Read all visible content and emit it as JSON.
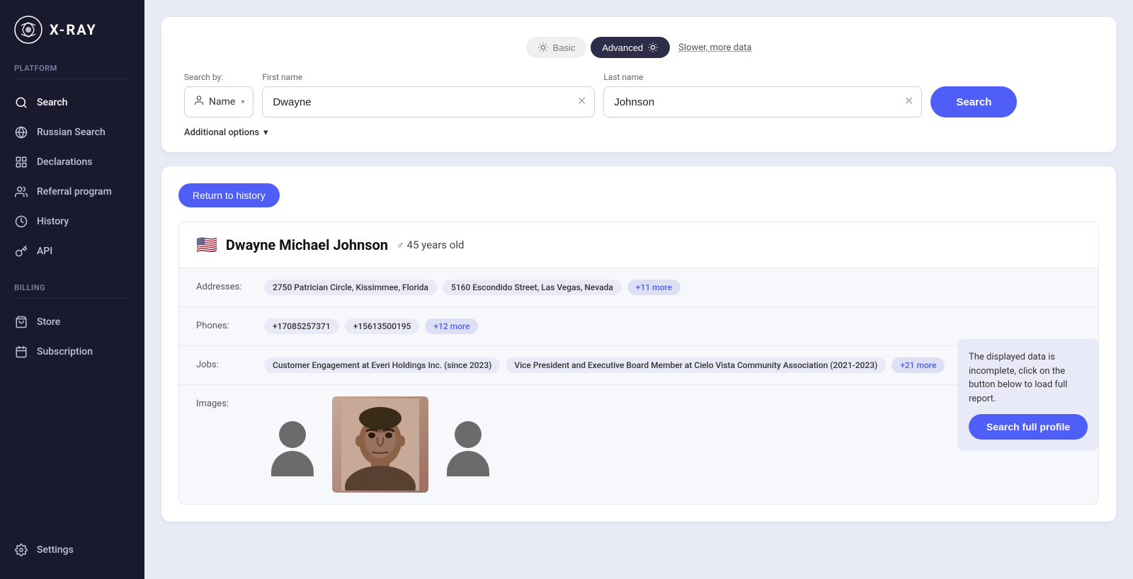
{
  "logo": {
    "text": "X-RAY"
  },
  "sidebar": {
    "platform_label": "Platform",
    "billing_label": "Billing",
    "items_platform": [
      {
        "id": "search",
        "label": "Search",
        "icon": "search"
      },
      {
        "id": "russian-search",
        "label": "Russian Search",
        "icon": "globe"
      },
      {
        "id": "declarations",
        "label": "Declarations",
        "icon": "grid"
      },
      {
        "id": "referral",
        "label": "Referral program",
        "icon": "users"
      },
      {
        "id": "history",
        "label": "History",
        "icon": "clock"
      },
      {
        "id": "api",
        "label": "API",
        "icon": "key"
      }
    ],
    "items_billing": [
      {
        "id": "store",
        "label": "Store",
        "icon": "bag"
      },
      {
        "id": "subscription",
        "label": "Subscription",
        "icon": "calendar"
      }
    ],
    "settings_label": "Settings"
  },
  "search": {
    "mode_basic": "Basic",
    "mode_advanced": "Advanced",
    "mode_note": "Slower, more data",
    "search_by_label": "Search by:",
    "search_by_value": "Name",
    "first_name_label": "First name",
    "first_name_value": "Dwayne",
    "last_name_label": "Last name",
    "last_name_value": "Johnson",
    "search_button_label": "Search",
    "additional_options_label": "Additional options"
  },
  "results": {
    "return_button": "Return to history",
    "profile": {
      "flag": "🇺🇸",
      "name": "Dwayne Michael Johnson",
      "gender_icon": "♂",
      "age": "45 years old",
      "addresses_label": "Addresses:",
      "addresses": [
        "2750 Patrician Circle, Kissimmee, Florida",
        "5160 Escondido Street, Las Vegas, Nevada",
        "+11 more"
      ],
      "phones_label": "Phones:",
      "phones": [
        "+17085257371",
        "+15613500195",
        "+12 more"
      ],
      "jobs_label": "Jobs:",
      "jobs": [
        "Customer Engagement at Everi Holdings Inc. (since 2023)",
        "Vice President and Executive Board Member at Cielo Vista Community Association (2021-2023)",
        "+21 more"
      ],
      "images_label": "Images:"
    },
    "tooltip": {
      "text": "The displayed data is incomplete, click on the button below to load full report.",
      "button_label": "Search full profile"
    }
  }
}
